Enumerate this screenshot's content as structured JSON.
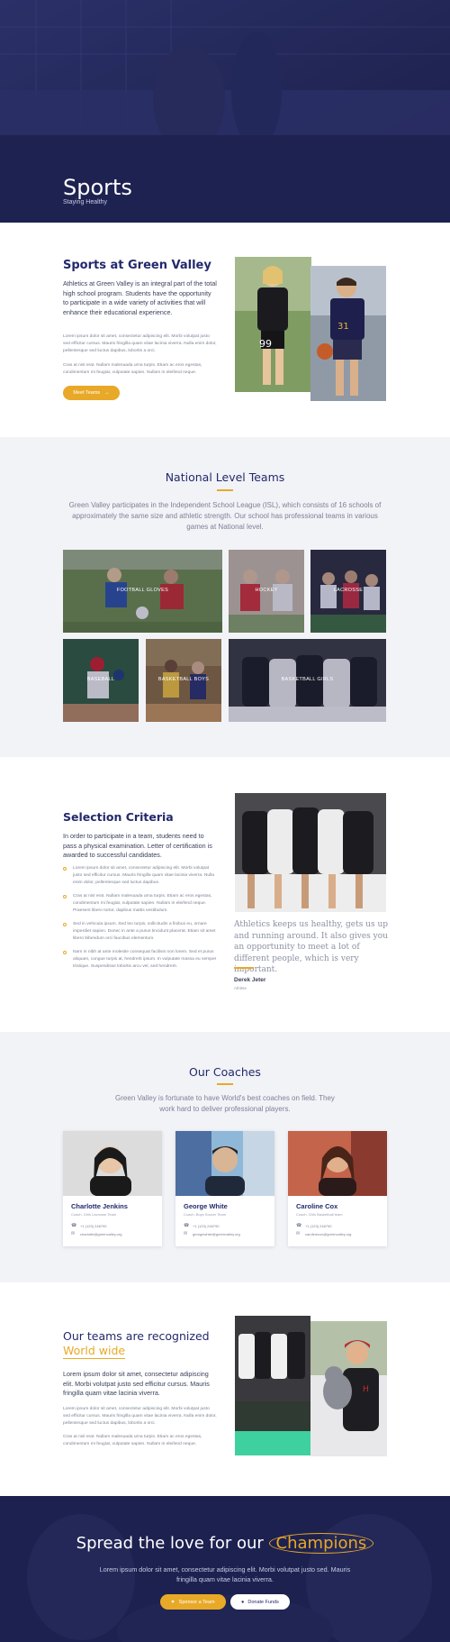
{
  "hero": {
    "title": "Sports",
    "subtitle": "Staying Healthy"
  },
  "intro": {
    "title": "Sports at Green Valley",
    "lead": "Athletics at Green Valley is an integral part of the total high school program. Students have the opportunity to participate in a wide variety of activities that will enhance their educational experience.",
    "p1": "Lorem ipsum dolor sit amet, consectetur adipiscing elit. Morbi volutpat justo sed efficitur cursus. Mauris fringilla quam vitae lacinia viverra. Nulla enim dolor, pellentesque sed luctus dapibus, lobortis a orci.",
    "p2": "Cras at nisl erat. Nullam malesuada urna turpis. Etiam ac eros egestas, condimentum mi feugiat, vulputate sapien. Nullam in eleifend neque.",
    "button": "Meet Teams",
    "button_icon": "arrow-right-icon"
  },
  "teams": {
    "title": "National Level Teams",
    "text": "Green Valley participates in the Independent School League (ISL), which consists of 16 schools of approximately the same size and athletic strength. Our school has professional teams in various games at National level.",
    "tiles": [
      {
        "label": "FOOTBALL GLOVES"
      },
      {
        "label": "HOCKEY"
      },
      {
        "label": "LACROSSE"
      },
      {
        "label": "BASEBALL"
      },
      {
        "label": "BASKETBALL BOYS"
      },
      {
        "label": "BASKETBALL GIRLS"
      }
    ]
  },
  "selection": {
    "title": "Selection Criteria",
    "lead": "In order to participate in a team, students need to pass a physical examination. Letter of certification is awarded to successful candidates.",
    "bullets": [
      "Lorem ipsum dolor sit amet, consectetur adipiscing elit. Morbi volutpat justo sed efficitur cursus. Mauris fringilla quam vitae lacinia viverra. Nulla enim dolor, pellentesque sed luctus dapibus.",
      "Cras at nisl erat. Nullam malesuada urna turpis. Etiam ac eros egestas, condimentum mi feugiat, vulputate sapien. Nullam in eleifend neque. Praesent libero tortor, dapibus mattis vestibulum.",
      "Sed in vehicula ipsum. Sed leo turpis, sollicitudin a finibus eu, ornare imperdiet sapien. Donec in ante a purus tincidunt placerat. Etiam sit amet libero bibendum orci faucibus elementum.",
      "Nam in nibh at ante molestie consequat facilisis non lorem. Sed et purus aliquam, congue turpis at, hendrerit ipsum. In vulputate massa eu semper tristique. Suspendisse lobortis arcu vel, sed hendrerit."
    ],
    "quote": "Athletics keeps us healthy, gets us up and running around. It also gives you an opportunity to meet a lot of different people, which is very important.",
    "author": "Derek Jeter",
    "author_role": "Athlete"
  },
  "coaches": {
    "title": "Our Coaches",
    "text": "Green Valley is fortunate to have World's best coaches on field. They work hard to deliver professional players.",
    "cards": [
      {
        "name": "Charlotte Jenkins",
        "role": "Coach, Girls Lacrosse Team",
        "phone": "+1 (123) 246790",
        "email": "charlotte@greenvalley.org"
      },
      {
        "name": "George White",
        "role": "Coach, Boys Soccer Team",
        "phone": "+1 (123) 246790",
        "email": "georgewhite@greenvalley.org"
      },
      {
        "name": "Caroline Cox",
        "role": "Coach, Girls Basketball team",
        "phone": "+1 (123) 246790",
        "email": "carolinecox@greenvalley.org"
      }
    ]
  },
  "recognized": {
    "title_line1": "Our teams are recognized",
    "title_line2": "World wide",
    "lead": "Lorem ipsum dolor sit amet, consectetur adipiscing elit. Morbi volutpat justo sed efficitur cursus. Mauris fringilla quam vitae lacinia viverra.",
    "p1": "Lorem ipsum dolor sit amet, consectetur adipiscing elit. Morbi volutpat justo sed efficitur cursus. Mauris fringilla quam vitae lacinia viverra. Nulla enim dolor, pellentesque sed luctus dapibus, lobortis a orci.",
    "p2": "Cras at nisl erat. Nullam malesuada urna turpis. Etiam ac eros egestas, condimentum mi feugiat, vulputate sapien. Nullam in eleifend neque."
  },
  "cta": {
    "title_prefix": "Spread the love for our",
    "title_highlight": "Champions",
    "text": "Lorem ipsum dolor sit amet, consectetur adipiscing elit. Morbi volutpat justo sed. Mauris fringilla quam vitae lacinia viverra.",
    "sponsor_button": "Sponsor a Team",
    "donate_button": "Donate Funds"
  },
  "colors": {
    "navy": "#23296b",
    "accent": "#e8a928",
    "hero_bg": "#1d2150",
    "section_alt": "#f2f3f7"
  }
}
